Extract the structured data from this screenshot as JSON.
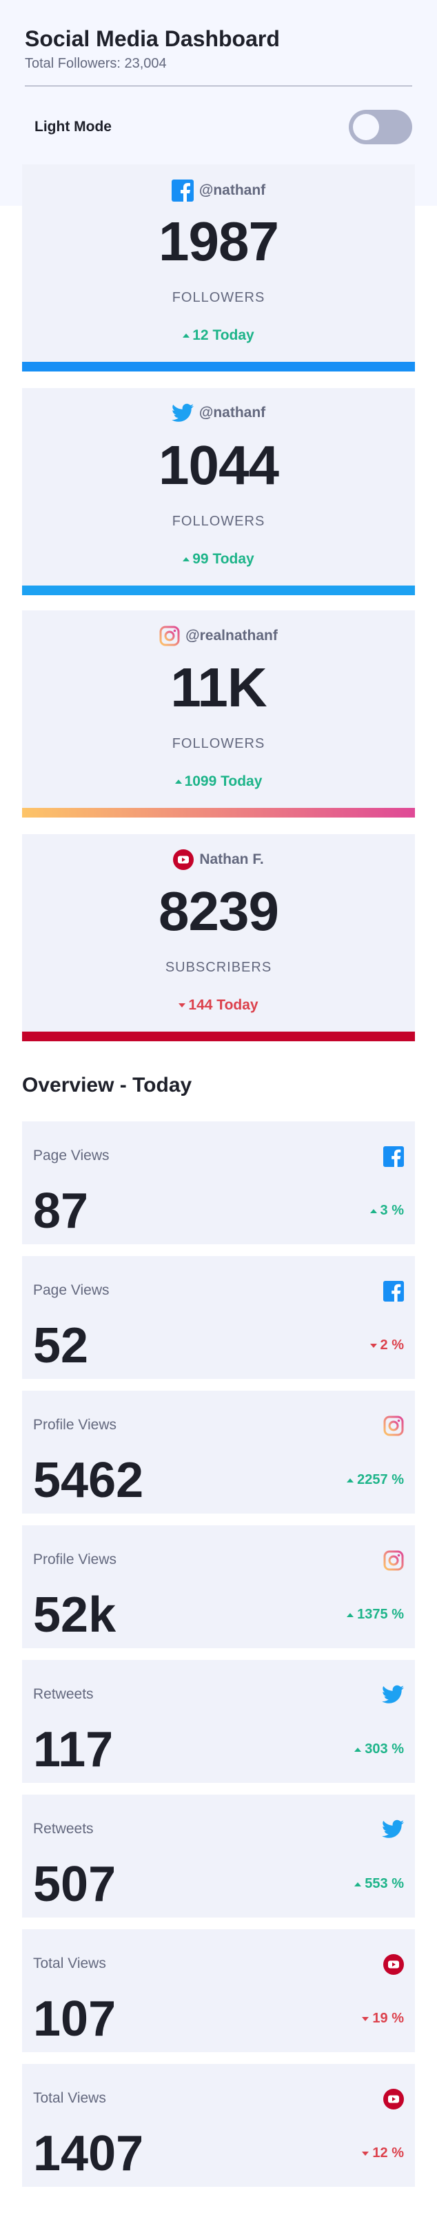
{
  "header": {
    "title": "Social Media Dashboard",
    "total_followers": "Total Followers: 23,004"
  },
  "mode": {
    "label": "Light Mode",
    "dark_mode_enabled": false
  },
  "colors": {
    "facebook": "#178ff5",
    "twitter": "#1da1f2",
    "instagram_start": "#fdc468",
    "instagram_end": "#df4996",
    "youtube": "#c4032a",
    "up": "#1db489",
    "down": "#dc414c"
  },
  "followers": [
    {
      "platform": "facebook",
      "icon": "facebook-icon",
      "handle": "@nathanf",
      "count": "1987",
      "label": "FOLLOWERS",
      "change": "12 Today",
      "direction": "up"
    },
    {
      "platform": "twitter",
      "icon": "twitter-icon",
      "handle": "@nathanf",
      "count": "1044",
      "label": "FOLLOWERS",
      "change": "99 Today",
      "direction": "up"
    },
    {
      "platform": "instagram",
      "icon": "instagram-icon",
      "handle": "@realnathanf",
      "count": "11K",
      "label": "FOLLOWERS",
      "change": "1099 Today",
      "direction": "up"
    },
    {
      "platform": "youtube",
      "icon": "youtube-icon",
      "handle": "Nathan F.",
      "count": "8239",
      "label": "SUBSCRIBERS",
      "change": "144 Today",
      "direction": "down"
    }
  ],
  "overview": {
    "title": "Overview - Today",
    "cards": [
      {
        "label": "Page Views",
        "icon": "facebook-icon",
        "value": "87",
        "change": "3 %",
        "direction": "up"
      },
      {
        "label": "Page Views",
        "icon": "facebook-icon",
        "value": "52",
        "change": "2 %",
        "direction": "down"
      },
      {
        "label": "Profile Views",
        "icon": "instagram-icon",
        "value": "5462",
        "change": "2257 %",
        "direction": "up"
      },
      {
        "label": "Profile Views",
        "icon": "instagram-icon",
        "value": "52k",
        "change": "1375 %",
        "direction": "up"
      },
      {
        "label": "Retweets",
        "icon": "twitter-icon",
        "value": "117",
        "change": "303 %",
        "direction": "up"
      },
      {
        "label": "Retweets",
        "icon": "twitter-icon",
        "value": "507",
        "change": "553 %",
        "direction": "up"
      },
      {
        "label": "Total Views",
        "icon": "youtube-icon",
        "value": "107",
        "change": "19 %",
        "direction": "down"
      },
      {
        "label": "Total Views",
        "icon": "youtube-icon",
        "value": "1407",
        "change": "12 %",
        "direction": "down"
      }
    ]
  }
}
